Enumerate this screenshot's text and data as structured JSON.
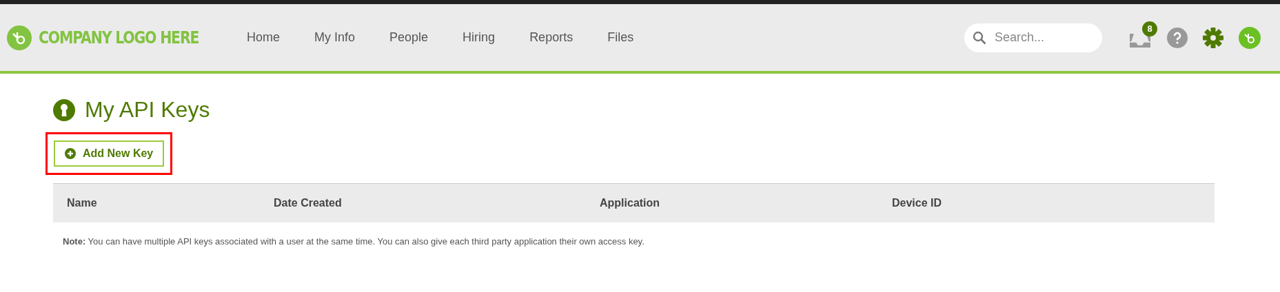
{
  "header": {
    "logo_text": "COMPANY LOGO HERE",
    "nav": [
      {
        "label": "Home",
        "selected": false
      },
      {
        "label": "My Info",
        "selected": false
      },
      {
        "label": "People",
        "selected": false
      },
      {
        "label": "Hiring",
        "selected": false
      },
      {
        "label": "Reports",
        "selected": false
      },
      {
        "label": "Files",
        "selected": false
      }
    ],
    "search": {
      "placeholder": "Search..."
    },
    "inbox_badge": "8"
  },
  "page": {
    "title": "My API Keys",
    "add_button": {
      "label": "Add New Key",
      "highlighted": true
    },
    "table": {
      "columns": [
        "Name",
        "Date Created",
        "Application",
        "Device ID"
      ]
    },
    "note": "**Note:** You can have multiple API keys associated with a user at the same time. You can also give each third party application their own access key."
  }
}
